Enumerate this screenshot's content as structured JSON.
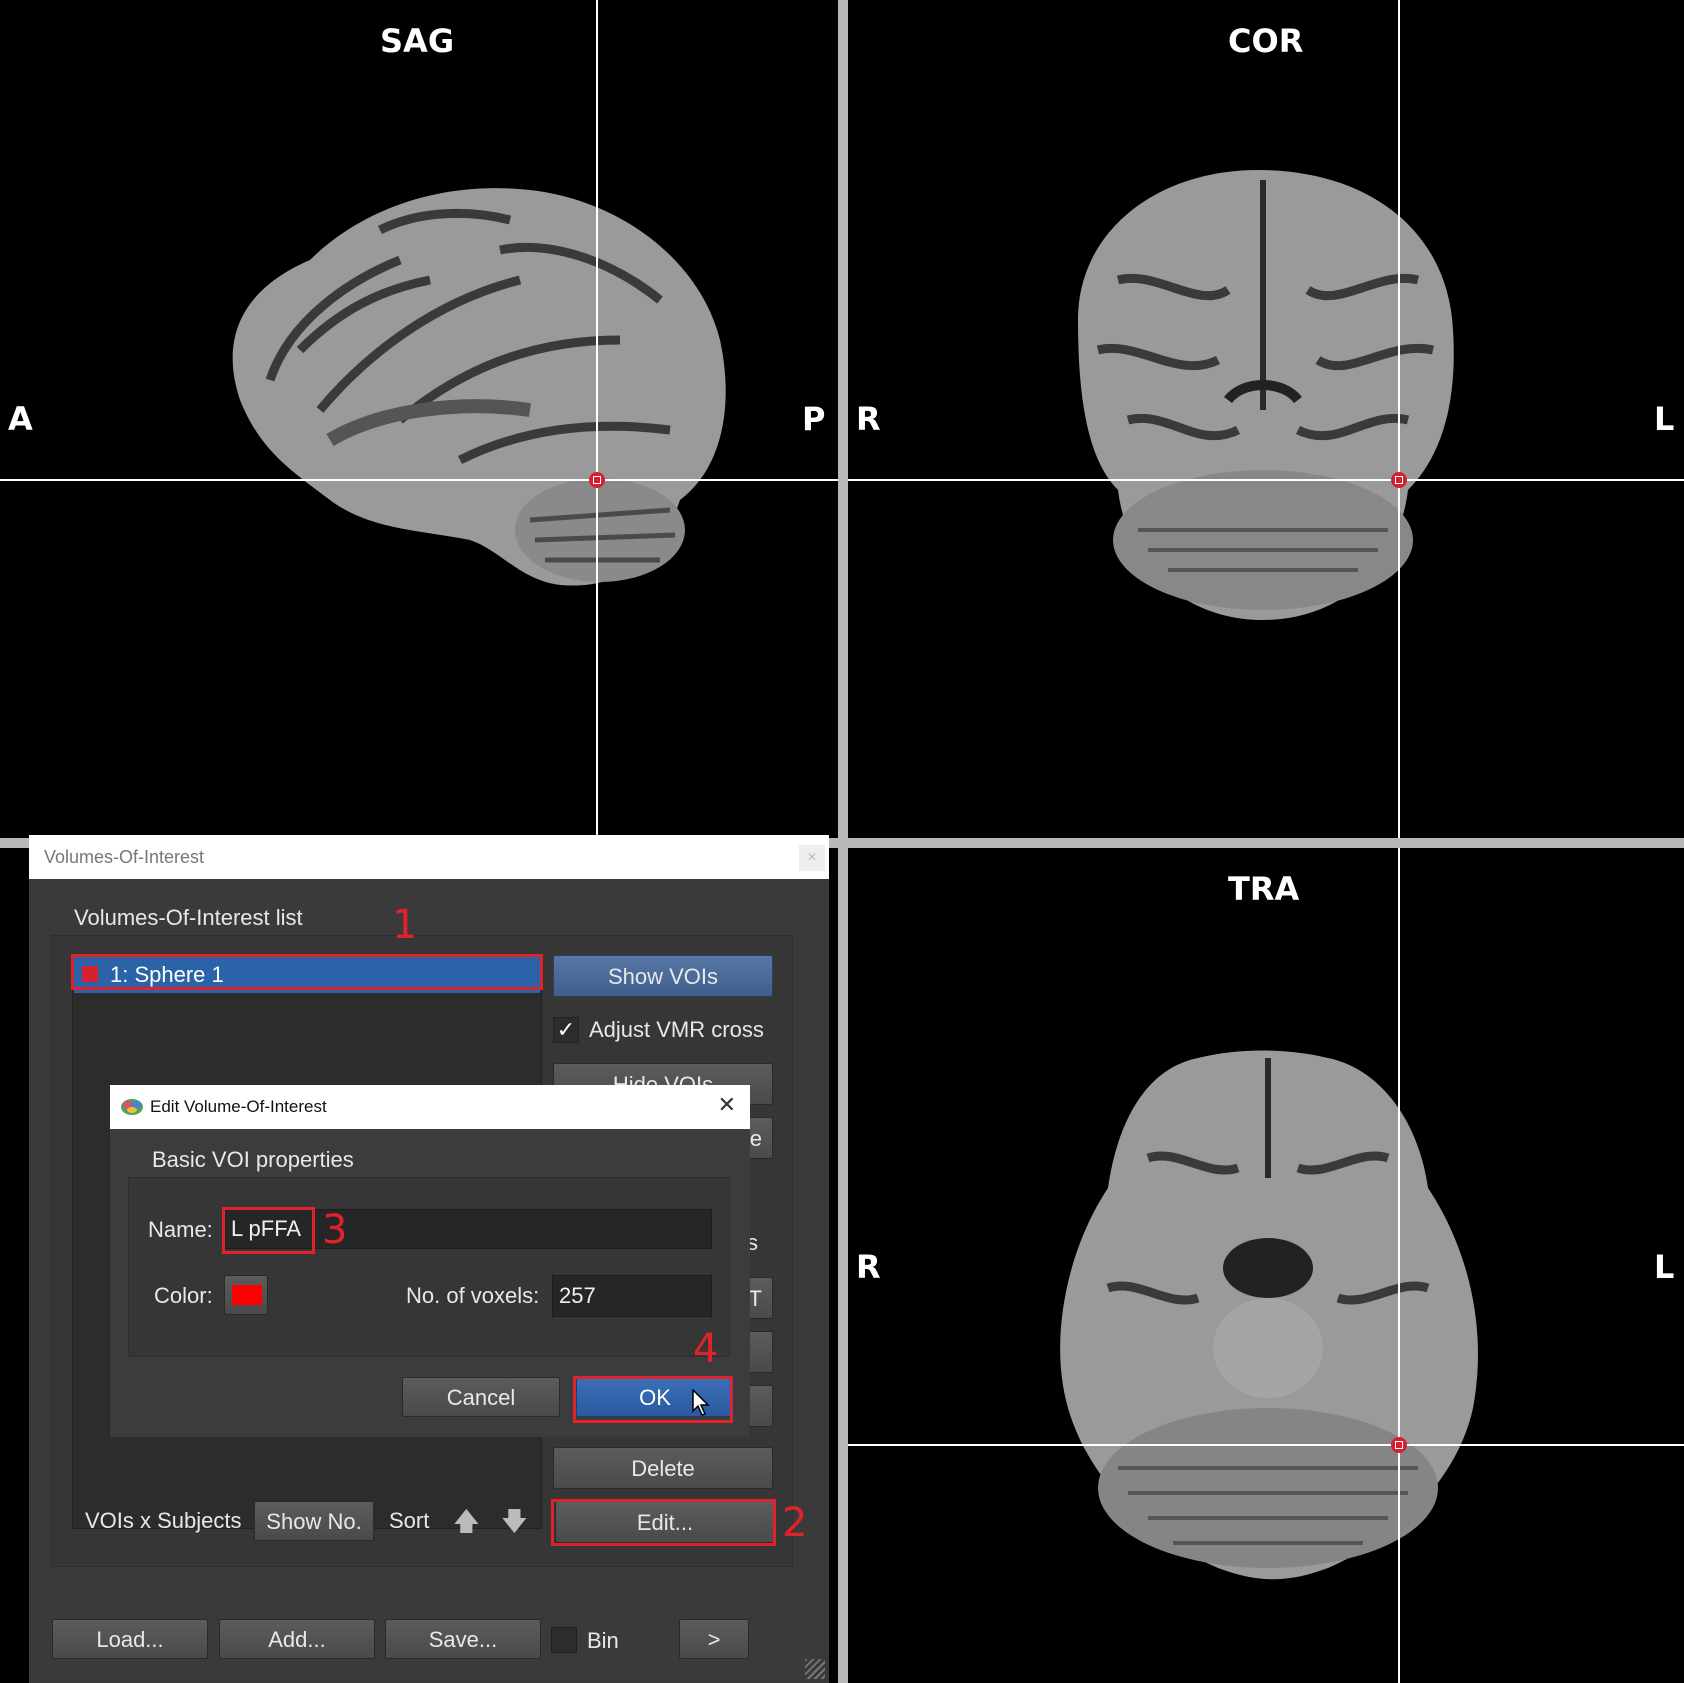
{
  "views": {
    "sagittal": {
      "title": "SAG",
      "left_label": "A",
      "right_label": "P"
    },
    "coronal": {
      "title": "COR",
      "left_label": "R",
      "right_label": "L"
    },
    "transversal": {
      "title": "TRA",
      "left_label": "R",
      "right_label": "L"
    }
  },
  "voi_dialog": {
    "window_title": "Volumes-Of-Interest",
    "close_glyph": "×",
    "list_label": "Volumes-Of-Interest list",
    "items": [
      {
        "label": "1: Sphere 1",
        "color": "#d42030"
      }
    ],
    "show_vois_button": "Show VOIs",
    "adjust_vmr_checkbox": {
      "label": "Adjust VMR cross",
      "checked": true,
      "glyph": "✓"
    },
    "hide_vois_button": "Hide VOIs",
    "delete_button": "Delete",
    "edit_button": "Edit...",
    "vois_x_subjects_label": "VOIs x Subjects",
    "show_no_button": "Show No.",
    "sort_label": "Sort",
    "sort_up_glyph": "🡅",
    "sort_down_glyph": "🡇",
    "load_button": "Load...",
    "add_button": "Add...",
    "save_button": "Save...",
    "bin_label": "Bin",
    "more_button": ">",
    "partial_labels": {
      "e": "e",
      "s": "s",
      "t": "T"
    }
  },
  "edit_dialog": {
    "title": "Edit Volume-Of-Interest",
    "close_glyph": "✕",
    "group_label": "Basic VOI properties",
    "name_label": "Name:",
    "name_value": "L pFFA",
    "color_label": "Color:",
    "color_value": "#ff0000",
    "voxels_label": "No. of voxels:",
    "voxels_value": "257",
    "cancel_button": "Cancel",
    "ok_button": "OK"
  },
  "step_markers": [
    "1",
    "2",
    "3",
    "4"
  ],
  "colors": {
    "highlight": "#e0222b",
    "selection": "#2b63a8",
    "voi_red": "#d42030"
  }
}
